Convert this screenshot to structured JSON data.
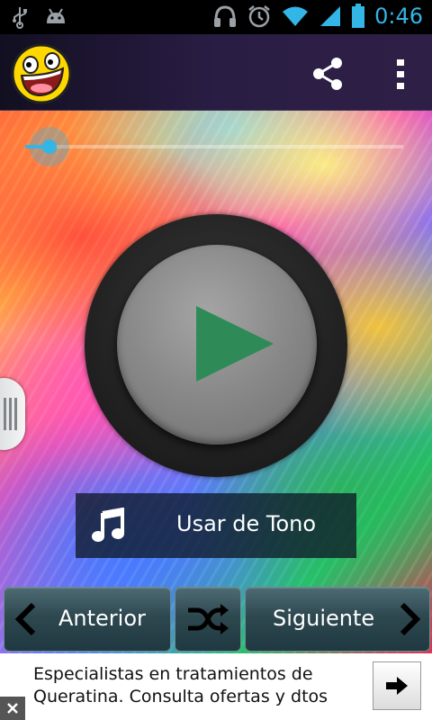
{
  "status_bar": {
    "time": "0:46",
    "icons": [
      "usb-icon",
      "android-icon",
      "headset-icon",
      "alarm-icon",
      "wifi-icon",
      "signal-icon",
      "battery-icon"
    ]
  },
  "action_bar": {
    "logo": "awesome-face-logo",
    "actions": [
      "share-icon",
      "overflow-menu-icon"
    ]
  },
  "player": {
    "progress": 0.0,
    "play_state": "paused"
  },
  "tone_button": {
    "label": "Usar de Tono"
  },
  "nav": {
    "prev_label": "Anterior",
    "next_label": "Siguiente"
  },
  "ad": {
    "text": "Especialistas en tratamientos de Queratina. Consulta ofertas y dtos"
  },
  "colors": {
    "accent": "#33b5e5",
    "play_triangle": "#2e8b57"
  }
}
